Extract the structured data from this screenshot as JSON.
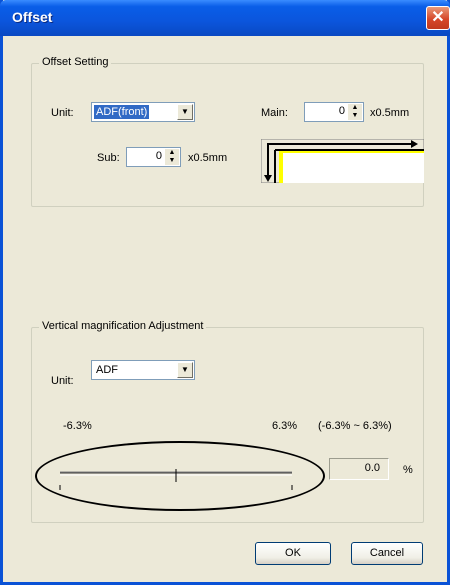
{
  "window": {
    "title": "Offset",
    "close_glyph": "✕"
  },
  "offset_setting": {
    "group_title": "Offset Setting",
    "unit_label": "Unit:",
    "unit_value": "ADF(front)",
    "main_label": "Main:",
    "main_value": "0",
    "main_unit": "x0.5mm",
    "sub_label": "Sub:",
    "sub_value": "0",
    "sub_unit": "x0.5mm"
  },
  "vertical_magnification": {
    "group_title": "Vertical magnification Adjustment",
    "unit_label": "Unit:",
    "unit_value": "ADF",
    "min_label": "-6.3%",
    "max_label": "6.3%",
    "range_label": "(-6.3% ~ 6.3%)",
    "slider_value": 0.0,
    "value_text": "0.0",
    "percent_sign": "%"
  },
  "buttons": {
    "ok": "OK",
    "cancel": "Cancel"
  },
  "icons": {
    "combo_arrow": "▼",
    "spin_up": "▲",
    "spin_down": "▼"
  },
  "colors": {
    "title_bar": "#0b55dc",
    "selection": "#316ac5",
    "dialog_bg": "#ece9d8",
    "diagram_page": "#ffff00"
  }
}
